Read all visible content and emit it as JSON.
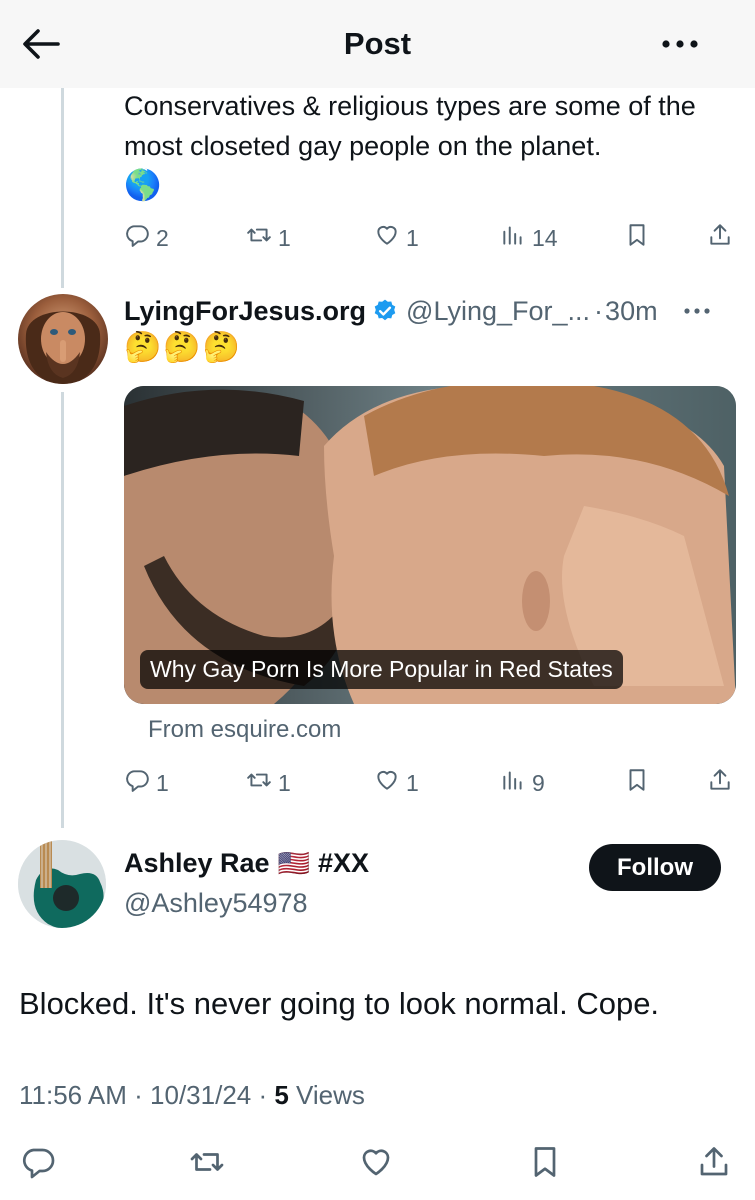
{
  "header": {
    "title": "Post"
  },
  "parent_tweet": {
    "text": "Conservatives & religious types are some of the most closeted gay people on the planet.",
    "emoji": "🌎",
    "actions": {
      "replies": "2",
      "retweets": "1",
      "likes": "1",
      "views": "14"
    }
  },
  "quoted_tweet": {
    "display_name": "LyingForJesus.org",
    "handle": "@Lying_For_...",
    "separator": "·",
    "time": "30m",
    "emojis": "🤔🤔🤔",
    "media_title": "Why Gay Porn Is More Popular in Red States",
    "source": "From esquire.com",
    "actions": {
      "replies": "1",
      "retweets": "1",
      "likes": "1",
      "views": "9"
    }
  },
  "main_tweet": {
    "display_name": "Ashley Rae",
    "flag": "🇺🇸",
    "tag": "#XX",
    "handle": "@Ashley54978",
    "follow_label": "Follow",
    "text": "Blocked. It's never going to look normal. Cope.",
    "timestamp": "11:56 AM · 10/31/24 · ",
    "views_count": "5",
    "views_label": " Views"
  },
  "colors": {
    "text": "#0f1419",
    "secondary": "#536471",
    "verified": "#1d9bf0",
    "thread": "#cfd9de"
  },
  "icons": [
    "back-arrow-icon",
    "more-icon",
    "reply-icon",
    "retweet-icon",
    "like-icon",
    "views-icon",
    "bookmark-icon",
    "share-icon",
    "verified-badge-icon"
  ]
}
